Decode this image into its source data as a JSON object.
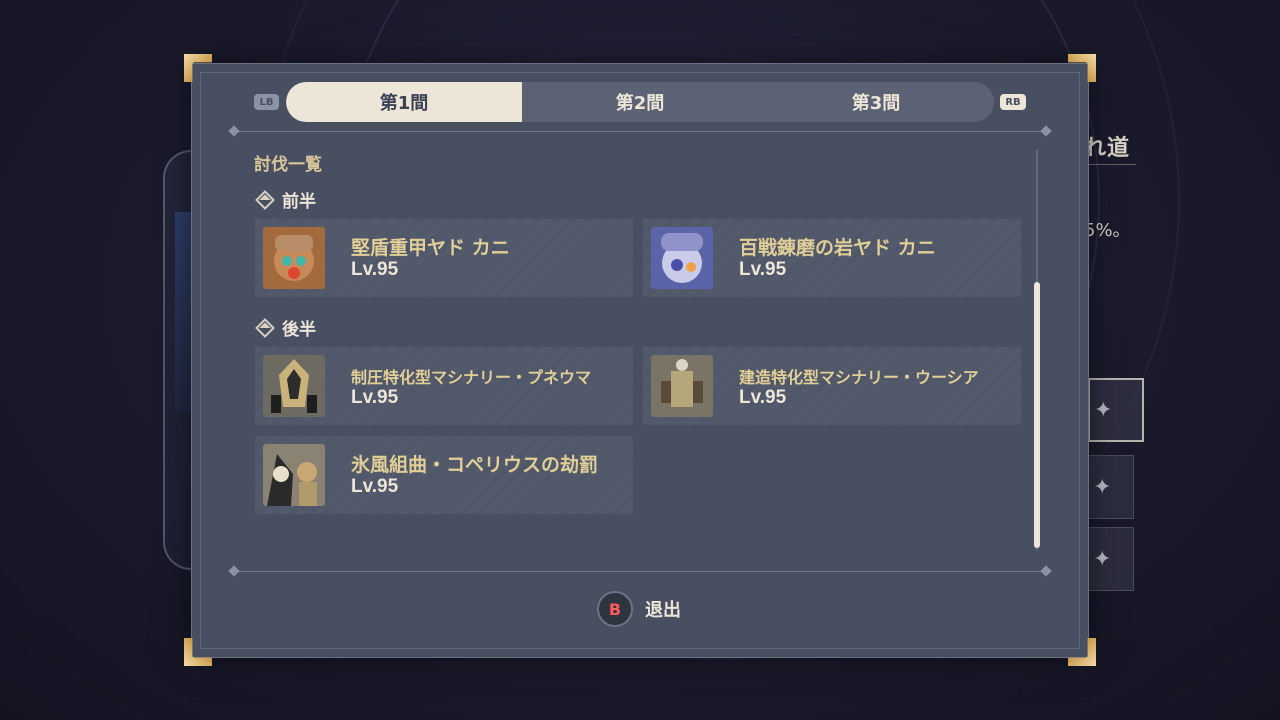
{
  "background": {
    "right_title": "れ道",
    "right_percent": "5%。"
  },
  "tabs": [
    {
      "label": "第1間",
      "active": true
    },
    {
      "label": "第2間",
      "active": false
    },
    {
      "label": "第3間",
      "active": false
    }
  ],
  "pad_buttons": {
    "left": "LB",
    "right": "RB"
  },
  "list": {
    "title": "討伐一覧",
    "first_half": {
      "label": "前半",
      "enemies": [
        {
          "name": "堅盾重甲ヤド カニ",
          "level": "Lv.95",
          "icon": "crab-armored-icon"
        },
        {
          "name": "百戦錬磨の岩ヤド カニ",
          "level": "Lv.95",
          "icon": "crab-rock-icon"
        }
      ]
    },
    "second_half": {
      "label": "後半",
      "enemies": [
        {
          "name": "制圧特化型マシナリー・プネウマ",
          "level": "Lv.95",
          "icon": "machinery-pneuma-icon"
        },
        {
          "name": "建造特化型マシナリー・ウーシア",
          "level": "Lv.95",
          "icon": "machinery-ousia-icon"
        },
        {
          "name": "氷風組曲・コペリウスの劫罰",
          "level": "Lv.95",
          "icon": "coppelius-icon"
        }
      ]
    }
  },
  "exit": {
    "button": "B",
    "label": "退出"
  },
  "colors": {
    "panel": "#474f61",
    "tab_active": "#ece5d8",
    "enemy_name": "#e2cf98",
    "corner_gold": "#c99a4d"
  }
}
